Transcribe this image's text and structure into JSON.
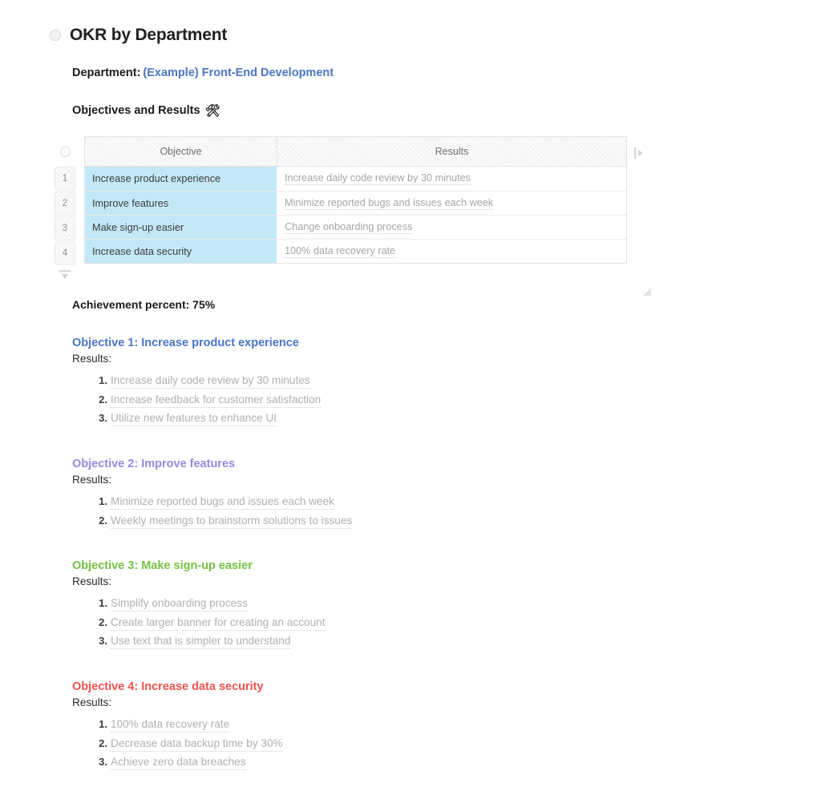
{
  "page": {
    "title": "OKR by Department",
    "bullet_icon": "radio-circle-icon"
  },
  "department": {
    "label": "Department:",
    "value": "(Example) Front-End Development",
    "value_color": "#4a76c4"
  },
  "section": {
    "heading": "Objectives and Results",
    "emoji": "🛠",
    "emoji_name": "hammer-and-wrench-emoji"
  },
  "table": {
    "columns": [
      "Objective",
      "Results"
    ],
    "row_numbers": [
      "1",
      "2",
      "3",
      "4"
    ],
    "rows": [
      {
        "objective": "Increase product experience",
        "result": "Increase daily code review by 30 minutes"
      },
      {
        "objective": "Improve features",
        "result": "Minimize reported bugs and issues each week"
      },
      {
        "objective": "Make sign-up easier",
        "result": "Change onboarding process"
      },
      {
        "objective": "Increase data security",
        "result": "100% data recovery rate"
      }
    ],
    "objective_cell_color": "#c3e8f8",
    "add_column_icon": "add-column-chevron-icon",
    "add_row_icon": "add-row-chevron-icon",
    "resize_icon": "resize-handle-icon",
    "select_all_icon": "select-all-circle-icon"
  },
  "achievement": {
    "text": "Achievement percent: 75%",
    "percent": "75%"
  },
  "objectives": [
    {
      "heading": "Objective 1: Increase product experience",
      "color": "#4a76c4",
      "results_label": "Results:",
      "results": [
        "Increase daily code review by 30 minutes",
        "Increase feedback for customer satisfaction",
        "Utilize new features to enhance UI"
      ]
    },
    {
      "heading": "Objective 2: Improve features",
      "color": "#9a86de",
      "results_label": "Results:",
      "results": [
        "Minimize reported bugs and issues each week",
        "Weekly meetings to brainstorm solutions to issues"
      ]
    },
    {
      "heading": "Objective 3: Make sign-up easier",
      "color": "#76c043",
      "results_label": "Results:",
      "results": [
        "Simplify onboarding process",
        "Create larger banner for creating an account",
        "Use text that is simpler to understand"
      ]
    },
    {
      "heading": "Objective 4: Increase data security",
      "color": "#f4524d",
      "results_label": "Results:",
      "results": [
        "100% data recovery rate",
        "Decrease data backup time by 30%",
        "Achieve zero data breaches"
      ]
    }
  ]
}
